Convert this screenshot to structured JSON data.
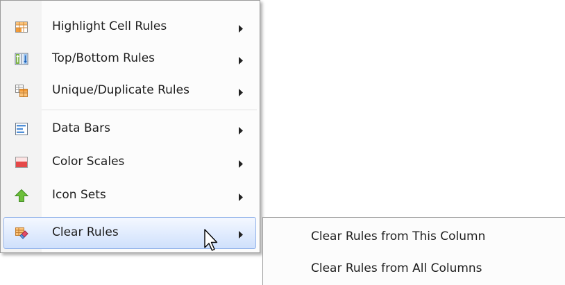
{
  "menu": {
    "items": [
      {
        "label": "Highlight Cell Rules",
        "icon": "highlight-cells-icon"
      },
      {
        "label": "Top/Bottom Rules",
        "icon": "top-bottom-icon"
      },
      {
        "label": "Unique/Duplicate Rules",
        "icon": "unique-duplicate-icon"
      },
      {
        "label": "Data Bars",
        "icon": "data-bars-icon"
      },
      {
        "label": "Color Scales",
        "icon": "color-scales-icon"
      },
      {
        "label": "Icon Sets",
        "icon": "icon-sets-icon"
      },
      {
        "label": "Clear Rules",
        "icon": "clear-rules-icon",
        "highlighted": true
      }
    ],
    "submenu_arrow": "▶"
  },
  "submenu": {
    "items": [
      {
        "label": "Clear Rules from This Column"
      },
      {
        "label": "Clear Rules from All Columns"
      }
    ]
  },
  "colors": {
    "highlight_fill": "#cfe0fc",
    "highlight_border": "#93b3ea",
    "menu_gutter": "#f3f3f3"
  }
}
